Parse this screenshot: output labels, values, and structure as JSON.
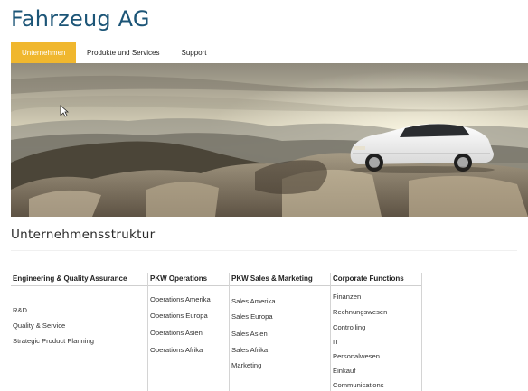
{
  "brand": {
    "title": "Fahrzeug AG"
  },
  "nav": {
    "tabs": [
      {
        "label": "Unternehmen",
        "active": true
      },
      {
        "label": "Produkte und Services",
        "active": false
      },
      {
        "label": "Support",
        "active": false
      }
    ]
  },
  "section": {
    "title": "Unternehmensstruktur"
  },
  "org_chart": {
    "columns": [
      {
        "header": "Engineering & Quality Assurance",
        "items": [
          "R&D",
          "Quality & Service",
          "Strategic Product Planning"
        ]
      },
      {
        "header": "PKW Operations",
        "items": [
          "Operations Amerika",
          "Operations Europa",
          "Operations Asien",
          "Operations Afrika"
        ]
      },
      {
        "header": "PKW Sales & Marketing",
        "items": [
          "Sales Amerika",
          "Sales Europa",
          "Sales Asien",
          "Sales Afrika",
          "Marketing"
        ]
      },
      {
        "header": "Corporate Functions",
        "items": [
          "Finanzen",
          "Rechnungswesen",
          "Controlling",
          "IT",
          "Personalwesen",
          "Einkauf",
          "Communications"
        ]
      }
    ]
  },
  "colors": {
    "brand": "#1c5577",
    "accent": "#f0b72e"
  }
}
